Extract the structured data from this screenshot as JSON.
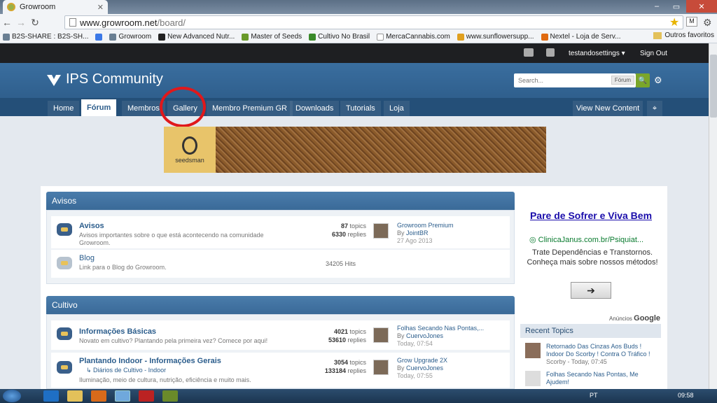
{
  "browser": {
    "tab_title": "Growroom",
    "url_host": "www.growroom.net",
    "url_path": "/board/",
    "bookmarks": [
      "B2S-SHARE : B2S-SH...",
      "Growroom",
      "New Advanced Nutr...",
      "Master of Seeds",
      "Cultivo No Brasil",
      "MercaCannabis.com",
      "www.sunflowersupp...",
      "Nextel - Loja de Serv..."
    ],
    "other_bookmarks": "Outros favoritos"
  },
  "userbar": {
    "username": "testandosettings ▾",
    "signout": "Sign Out"
  },
  "header": {
    "logo": "IPS Community",
    "search_placeholder": "Search...",
    "search_scope": "Fórum",
    "nav": [
      "Home",
      "Fórum",
      "Membros",
      "Gallery",
      "Membro Premium GR",
      "Downloads",
      "Tutorials",
      "Loja"
    ],
    "view_new": "View New Content"
  },
  "banner": {
    "brand": "seedsman"
  },
  "categories": [
    {
      "title": "Avisos",
      "forums": [
        {
          "title": "Avisos",
          "desc": "Avisos importantes sobre o que está acontecendo na comunidade Growroom.",
          "topics": "87",
          "topics_label": "topics",
          "replies": "6330",
          "replies_label": "replies",
          "last_title": "Growroom Premium",
          "last_by": "By",
          "last_user": "JointBR",
          "last_date": "27 Ago 2013"
        },
        {
          "title": "Blog",
          "desc": "Link para o Blog do Growroom.",
          "hits": "34205 Hits"
        }
      ]
    },
    {
      "title": "Cultivo",
      "forums": [
        {
          "title": "Informações Básicas",
          "desc": "Novato em cultivo? Plantando pela primeira vez? Comece por aqui!",
          "topics": "4021",
          "topics_label": "topics",
          "replies": "53610",
          "replies_label": "replies",
          "last_title": "Folhas Secando Nas Pontas,...",
          "last_by": "By",
          "last_user": "CuervoJones",
          "last_date": "Today, 07:54"
        },
        {
          "title": "Plantando Indoor - Informações Gerais",
          "sub": "Diários de Cultivo - Indoor",
          "desc": "Iluminação, meio de cultura, nutrição, eficiência e muito mais.",
          "topics": "3054",
          "topics_label": "topics",
          "replies": "133184",
          "replies_label": "replies",
          "last_title": "Grow Upgrade 2X",
          "last_by": "By",
          "last_user": "CuervoJones",
          "last_date": "Today, 07:55"
        }
      ]
    }
  ],
  "sidebar": {
    "ad_title": "Pare de Sofrer e Viva Bem",
    "ad_url": "ClinicaJanus.com.br/Psiquiat...",
    "ad_text": "Trate Dependências e Transtornos. Conheça mais sobre nossos métodos!",
    "ad_by": "Anúncios",
    "ad_brand": "Google",
    "recent_header": "Recent Topics",
    "recent": [
      {
        "title": "Retornado Das Cinzas Aos Buds ! Indoor Do Scorby ! Contra O Tráfico !",
        "meta": "Scorby - Today, 07:45"
      },
      {
        "title": "Folhas Secando Nas Pontas, Me Ajudem!",
        "meta": ""
      }
    ]
  },
  "taskbar": {
    "lang": "PT",
    "clock": "09:58"
  }
}
